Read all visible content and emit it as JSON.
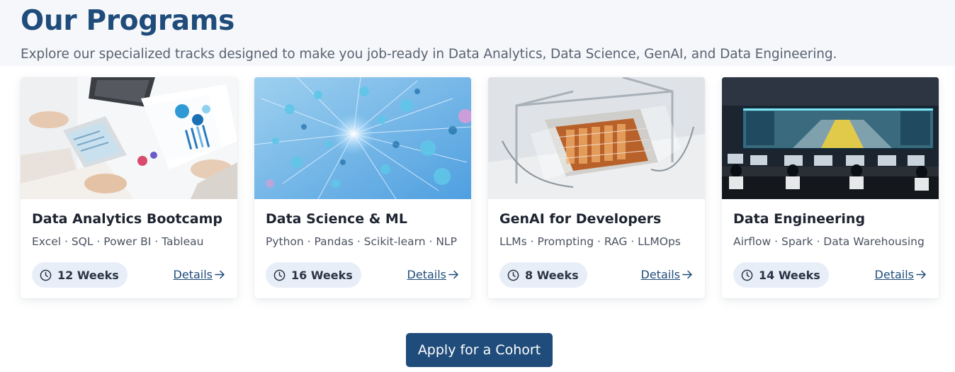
{
  "header": {
    "title": "Our Programs",
    "subtitle": "Explore our specialized tracks designed to make you job-ready in Data Analytics, Data Science, GenAI, and Data Engineering."
  },
  "programs": [
    {
      "title": "Data Analytics Bootcamp",
      "tags": "Excel · SQL · Power BI · Tableau",
      "duration": "12 Weeks",
      "details_label": "Details",
      "image": "analytics-desk-photo"
    },
    {
      "title": "Data Science & ML",
      "tags": "Python · Pandas · Scikit-learn · NLP",
      "duration": "16 Weeks",
      "details_label": "Details",
      "image": "molecules-network-render"
    },
    {
      "title": "GenAI for Developers",
      "tags": "LLMs · Prompting · RAG · LLMOps",
      "duration": "8 Weeks",
      "details_label": "Details",
      "image": "glass-chip-render"
    },
    {
      "title": "Data Engineering",
      "tags": "Airflow · Spark · Data Warehousing",
      "duration": "14 Weeks",
      "details_label": "Details",
      "image": "control-room-photo"
    }
  ],
  "cta": {
    "label": "Apply for a Cohort"
  },
  "colors": {
    "brand": "#1f4c7a",
    "pill_bg": "#e8eef8",
    "hero_bg": "#f5f7fb"
  },
  "icons": {
    "duration": "clock-icon",
    "details": "arrow-right-icon"
  }
}
